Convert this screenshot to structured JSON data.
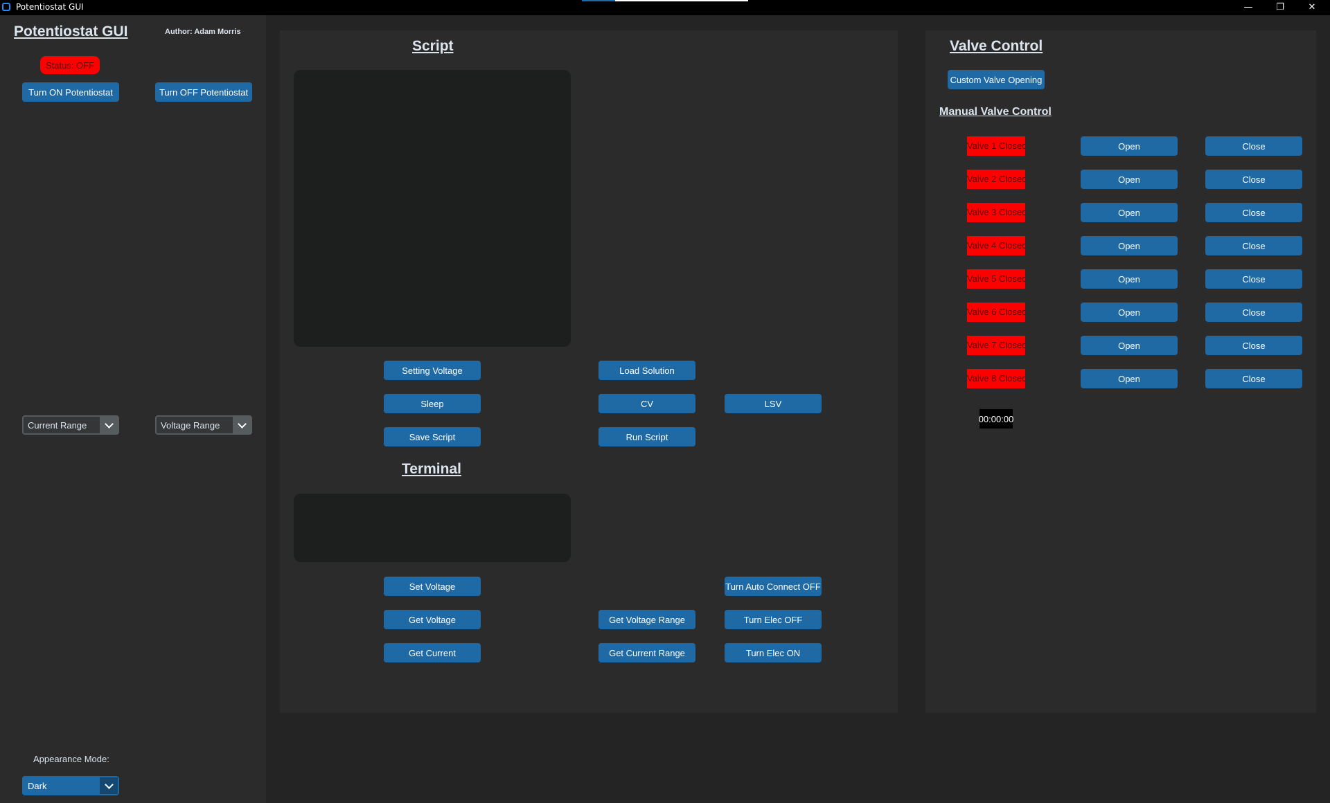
{
  "window": {
    "title": "Potentiostat GUI"
  },
  "sidebar": {
    "app_title": "Potentiostat GUI",
    "author": "Author: Adam Morris",
    "status": "Status: OFF",
    "turn_on": "Turn ON Potentiostat",
    "turn_off": "Turn OFF Potentiostat",
    "current_range": "Current Range",
    "voltage_range": "Voltage Range",
    "appearance_label": "Appearance Mode:",
    "appearance_value": "Dark"
  },
  "script": {
    "title": "Script",
    "buttons": {
      "setting_voltage": "Setting Voltage",
      "load_solution": "Load Solution",
      "sleep": "Sleep",
      "cv": "CV",
      "lsv": "LSV",
      "save_script": "Save Script",
      "run_script": "Run Script"
    }
  },
  "terminal": {
    "title": "Terminal",
    "buttons": {
      "set_voltage": "Set Voltage",
      "auto_connect_off": "Turn Auto Connect OFF",
      "get_voltage": "Get Voltage",
      "get_voltage_range": "Get Voltage Range",
      "elec_off": "Turn Elec OFF",
      "get_current": "Get Current",
      "get_current_range": "Get Current Range",
      "elec_on": "Turn Elec ON"
    }
  },
  "valve": {
    "title": "Valve Control",
    "custom": "Custom Valve Opening",
    "manual_title": "Manual Valve Control",
    "open_label": "Open",
    "close_label": "Close",
    "valves": [
      "Valve 1 Closed",
      "Valve 2 Closed",
      "Valve 3 Closed",
      "Valve 4 Closed",
      "Valve 5 Closed",
      "Valve 6 Closed",
      "Valve 7 Closed",
      "Valve 8 Closed"
    ],
    "timer": "00:00:00"
  },
  "colors": {
    "accent": "#1f6aa5",
    "status_off": "#ff0000",
    "panel": "#2b2b2b",
    "background": "#242424"
  }
}
